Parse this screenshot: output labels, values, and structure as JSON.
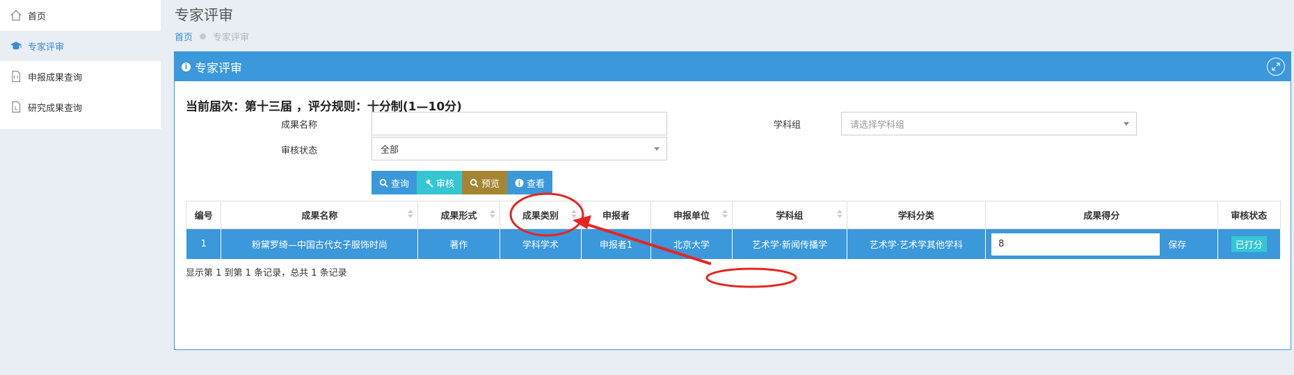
{
  "sidebar": {
    "items": [
      {
        "label": "首页",
        "icon": "home-icon"
      },
      {
        "label": "专家评审",
        "icon": "graduation-cap-icon"
      },
      {
        "label": "申报成果查询",
        "icon": "code-file-icon"
      },
      {
        "label": "研究成果查询",
        "icon": "document-icon"
      }
    ]
  },
  "header": {
    "title": "专家评审",
    "breadcrumb": {
      "home": "首页",
      "current": "专家评审"
    }
  },
  "panel": {
    "title": "专家评审",
    "round_info": "当前届次：第十三届 ，评分规则：十分制(1—10分)",
    "filters": {
      "name_label": "成果名称",
      "name_value": "",
      "subject_group_label": "学科组",
      "subject_group_placeholder": "请选择学科组",
      "status_label": "审核状态",
      "status_value": "全部"
    },
    "buttons": {
      "query": "查询",
      "audit": "审核",
      "preview": "预览",
      "view": "查看"
    },
    "table": {
      "headers": [
        "编号",
        "成果名称",
        "成果形式",
        "成果类别",
        "申报者",
        "申报单位",
        "学科组",
        "学科分类",
        "成果得分",
        "审核状态"
      ],
      "rows": [
        {
          "no": "1",
          "name": "粉黛罗绮—中国古代女子服饰时尚",
          "form": "著作",
          "category": "学科学术",
          "applicant": "申报者1",
          "unit": "北京大学",
          "group": "艺术学·新闻传播学",
          "classification": "艺术学·艺术学其他学科",
          "score": "8",
          "save": "保存",
          "status": "已打分"
        }
      ]
    },
    "footer": "显示第 1 到第 1 条记录，总共 1 条记录"
  },
  "colors": {
    "primary": "#3a98db",
    "teal": "#36c6d3",
    "preview": "#a58532",
    "annotation": "#e8231f"
  }
}
